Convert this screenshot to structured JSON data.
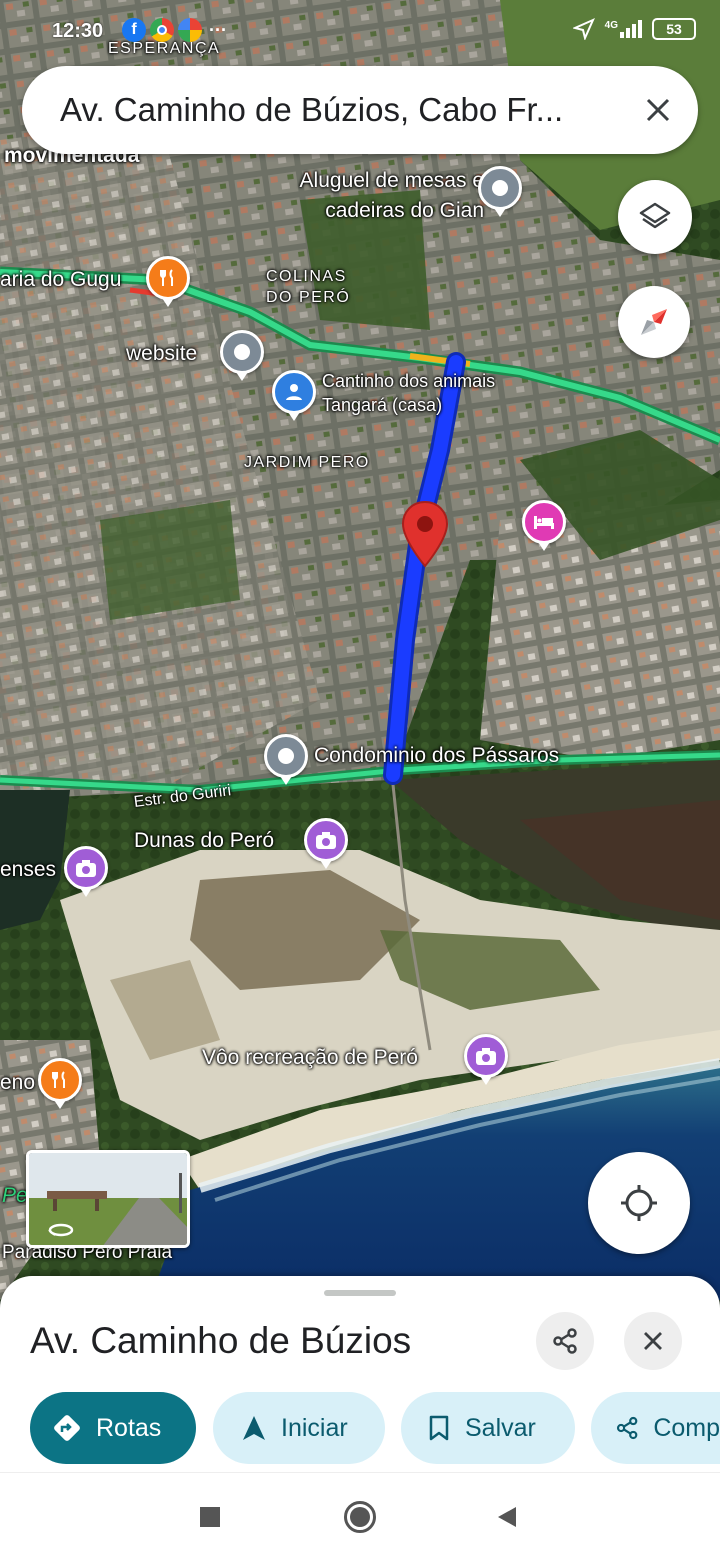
{
  "status_bar": {
    "time": "12:30",
    "app_icons": [
      "facebook-icon",
      "chrome-icon",
      "photos-icon"
    ],
    "more": "···",
    "network": "4G",
    "battery": "53"
  },
  "search": {
    "query": "Av. Caminho de Búzios, Cabo Fr...",
    "clear_icon": "close-icon"
  },
  "map": {
    "labels": {
      "esperanca": "ESPERANÇA",
      "movimentada": "movimentada",
      "aluguel": "Aluguel de mesas e cadeiras do Gian",
      "pizzaria": "aria do Gugu",
      "colinas": "COLINAS DO PERÓ",
      "website": "website",
      "cantinho": "Cantinho dos animais Tangará (casa)",
      "jardim": "JARDIM PERO",
      "condominio": "Condominio dos Pássaros",
      "estrada": "Estr. do Guriri",
      "dunas": "Dunas do Peró",
      "enses": "enses",
      "voo": "Vôo recreação de Peró",
      "eno": "eno",
      "paradiso": "Paradiso Pero Praia",
      "pe": "Pe"
    },
    "route_color": "#1a3cff",
    "highway_color": "#2fd17a",
    "selected_pin_color": "#e0312d"
  },
  "controls": {
    "layers_icon": "layers-icon",
    "compass_icon": "compass-icon",
    "location_icon": "my-location-icon"
  },
  "sheet": {
    "title": "Av. Caminho de Búzios",
    "actions": {
      "directions": "Rotas",
      "start": "Iniciar",
      "save": "Salvar",
      "share": "Comp"
    }
  }
}
